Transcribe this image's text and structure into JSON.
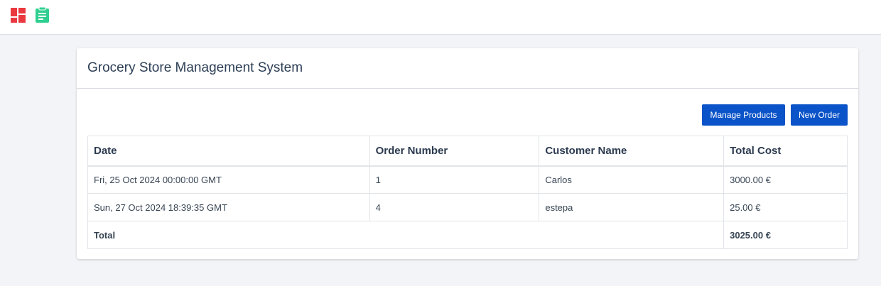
{
  "app": {
    "title": "Grocery Store Management System"
  },
  "colors": {
    "accent": "#0a53c8",
    "logo_red": "#e9393f",
    "logo_green": "#2ecf8f"
  },
  "icons": {
    "dashboard": "dashboard-grid-icon",
    "orders": "clipboard-icon"
  },
  "toolbar": {
    "manage_products_label": "Manage Products",
    "new_order_label": "New Order"
  },
  "table": {
    "headers": {
      "date": "Date",
      "order_number": "Order Number",
      "customer_name": "Customer Name",
      "total_cost": "Total Cost"
    },
    "rows": [
      {
        "date": "Fri, 25 Oct 2024 00:00:00 GMT",
        "order_number": "1",
        "customer_name": "Carlos",
        "total_cost": "3000.00 €"
      },
      {
        "date": "Sun, 27 Oct 2024 18:39:35 GMT",
        "order_number": "4",
        "customer_name": "estepa",
        "total_cost": "25.00 €"
      }
    ],
    "footer": {
      "total_label": "Total",
      "total_value": "3025.00 €"
    }
  }
}
